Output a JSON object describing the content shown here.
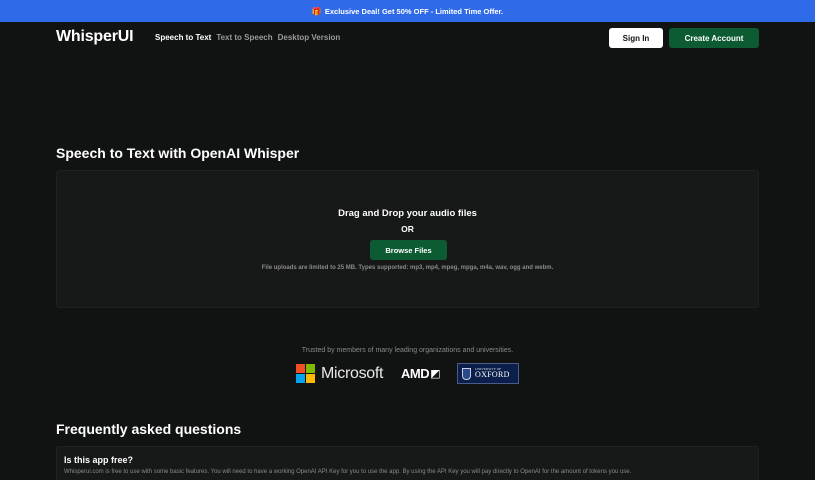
{
  "promo": {
    "icon": "gift-icon",
    "text": "Exclusive Deal! Get 50% OFF - Limited Time Offer."
  },
  "header": {
    "logo": "WhisperUI",
    "nav": [
      "Speech to Text",
      "Text to Speech",
      "Desktop Version"
    ],
    "sign_in": "Sign In",
    "create_account": "Create Account"
  },
  "main": {
    "title": "Speech to Text with OpenAI Whisper",
    "dropzone": {
      "heading": "Drag and Drop your audio files",
      "or": "OR",
      "browse": "Browse Files",
      "note": "File uploads are limited to 25 MB. Types supported: mp3, mp4, mpeg, mpga, m4a, wav, ogg and webm."
    }
  },
  "trusted": {
    "text": "Trusted by members of many leading organizations and universities.",
    "microsoft": "Microsoft",
    "amd": "AMD",
    "oxford_small": "UNIVERSITY OF",
    "oxford_big": "OXFORD"
  },
  "faq": {
    "title": "Frequently asked questions",
    "items": [
      {
        "question": "Is this app free?",
        "answer": "Whisperui.com is free to use with some basic features. You will need to have a working OpenAI API Key for you to use the app. By using the API Key you will pay directly to OpenAI for the amount of tokens you use."
      }
    ]
  },
  "colors": {
    "background": "#111212",
    "promo_bar": "#2f6ae8",
    "accent_green": "#0d5b33",
    "card": "#171818",
    "muted_text": "#8a8a8a",
    "ms_red": "#f25022",
    "ms_green": "#7fba00",
    "ms_blue": "#00a4ef",
    "ms_yellow": "#ffb900"
  }
}
